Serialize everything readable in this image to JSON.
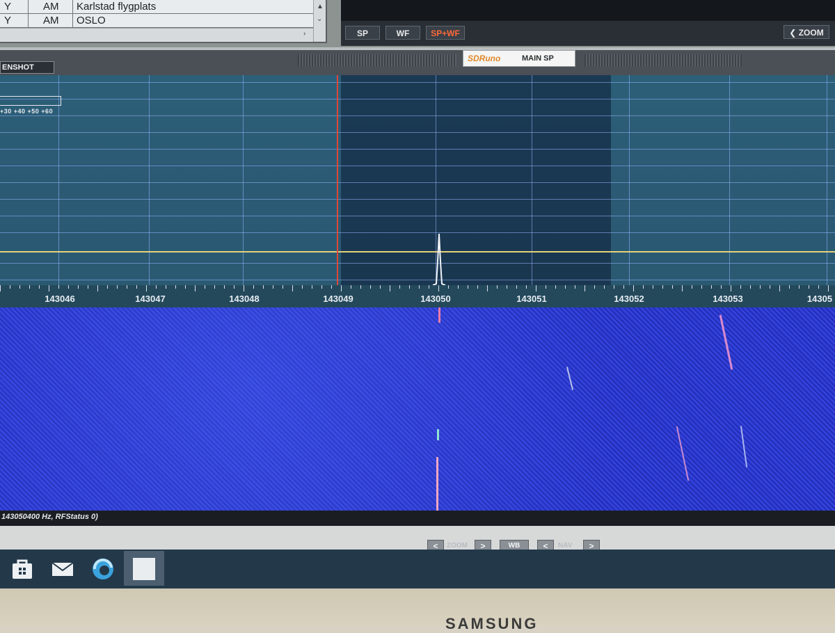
{
  "memory_list": {
    "rows": [
      {
        "col1": "Y",
        "col2": "AM",
        "name": "Karlstad flygplats"
      },
      {
        "col1": "Y",
        "col2": "AM",
        "name": "OSLO"
      }
    ]
  },
  "spectrum_buttons": {
    "sp": "SP",
    "wf": "WF",
    "sp_wf": "SP+WF",
    "zoom": "ZOOM"
  },
  "main_window": {
    "screenshot_label": "ENSHOT",
    "brand": "SDRuno",
    "title": "MAIN SP"
  },
  "spectrum": {
    "scale_labels": "+30  +40  +50  +60",
    "frequency_labels": [
      "143046",
      "143047",
      "143048",
      "143049",
      "143050",
      "143051",
      "143052",
      "143053",
      "14305"
    ],
    "colors": {
      "tune_marker": "#e0463a",
      "reference_line": "#e6d27a",
      "waterfall": "#2c3cd0"
    }
  },
  "status": {
    "text": "143050400 Hz, RFStatus 0)"
  },
  "bottom_nav": {
    "prev_icon": "<",
    "next_icon": ">",
    "zoom_label": "ZOOM",
    "wb_label": "WB",
    "nav_label": "NAV"
  },
  "taskbar": {
    "icons": [
      "store-icon",
      "mail-icon",
      "edge-browser-icon",
      "active-app-icon"
    ]
  },
  "monitor": {
    "brand": "SAMSUNG"
  }
}
